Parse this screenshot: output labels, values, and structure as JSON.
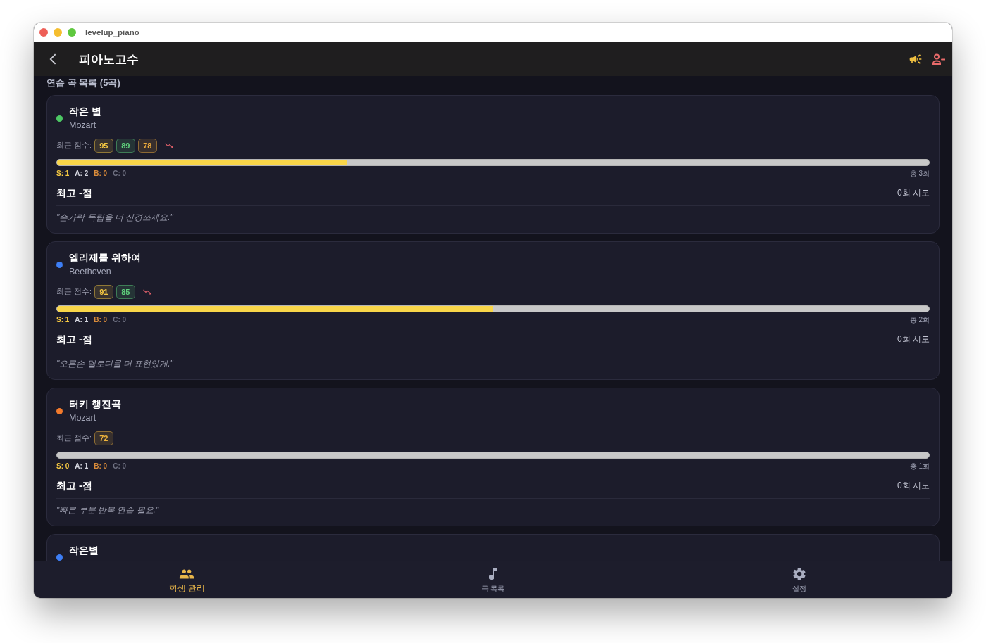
{
  "window": {
    "title": "levelup_piano"
  },
  "app_bar": {
    "title": "피아노고수"
  },
  "section_title": "연습 곡 목록 (5곡)",
  "songs": [
    {
      "title": "작은 별",
      "composer": "Mozart",
      "color": "#4cc764",
      "scores_label": "최근 점수:",
      "scores": [
        {
          "value": "95",
          "color": "#f5c842"
        },
        {
          "value": "89",
          "color": "#5fd17c"
        },
        {
          "value": "78",
          "color": "#f0ad3c"
        }
      ],
      "trend_down": true,
      "level": 0.333,
      "grade_counts": [
        {
          "text": "S: 1",
          "color": "#f5c842"
        },
        {
          "text": "A: 2",
          "color": "#d6d7e0"
        },
        {
          "text": "B: 0",
          "color": "#d98b3a"
        },
        {
          "text": "C: 0",
          "color": "#6f7182"
        }
      ],
      "total": "총 3회",
      "best": "최고 -점",
      "attempts": "0회 시도",
      "comment": "\"손가락 독립을 더 신경쓰세요.\""
    },
    {
      "title": "엘리제를 위하여",
      "composer": "Beethoven",
      "color": "#3d7ef5",
      "scores_label": "최근 점수:",
      "scores": [
        {
          "value": "91",
          "color": "#f5c842"
        },
        {
          "value": "85",
          "color": "#5fd17c"
        }
      ],
      "trend_down": true,
      "level": 0.5,
      "grade_counts": [
        {
          "text": "S: 1",
          "color": "#f5c842"
        },
        {
          "text": "A: 1",
          "color": "#d6d7e0"
        },
        {
          "text": "B: 0",
          "color": "#d98b3a"
        },
        {
          "text": "C: 0",
          "color": "#6f7182"
        }
      ],
      "total": "총 2회",
      "best": "최고 -점",
      "attempts": "0회 시도",
      "comment": "\"오른손 멜로디를 더 표현있게.\""
    },
    {
      "title": "터키 행진곡",
      "composer": "Mozart",
      "color": "#f27a2c",
      "scores_label": "최근 점수:",
      "scores": [
        {
          "value": "72",
          "color": "#f0b43c"
        }
      ],
      "trend_down": false,
      "level": 0,
      "grade_counts": [
        {
          "text": "S: 0",
          "color": "#f5c842"
        },
        {
          "text": "A: 1",
          "color": "#d6d7e0"
        },
        {
          "text": "B: 0",
          "color": "#d98b3a"
        },
        {
          "text": "C: 0",
          "color": "#6f7182"
        }
      ],
      "total": "총 1회",
      "best": "최고 -점",
      "attempts": "0회 시도",
      "comment": "\"빠른 부분 반복 연습 필요.\""
    },
    {
      "title": "작은별",
      "color": "#3d7ef5"
    }
  ],
  "bottom_nav": [
    {
      "label": "학생 관리",
      "selected": true
    },
    {
      "label": "곡 목록",
      "selected": false
    },
    {
      "label": "설정",
      "selected": false
    }
  ]
}
